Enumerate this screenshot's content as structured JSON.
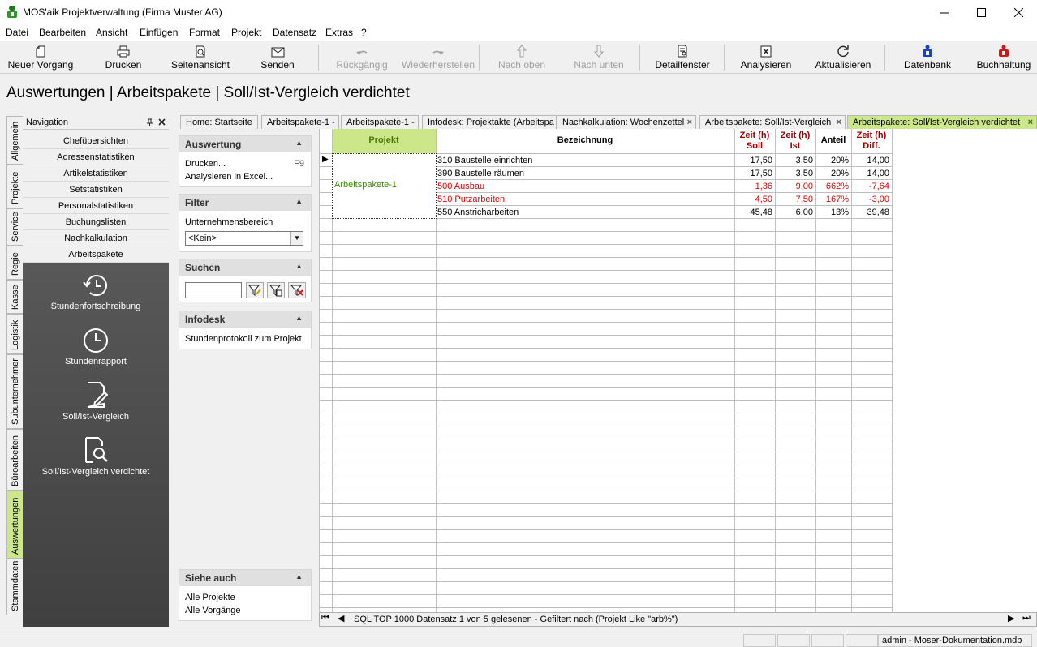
{
  "window": {
    "title": "MOS'aik Projektverwaltung (Firma Muster AG)"
  },
  "menu": [
    "Datei",
    "Bearbeiten",
    "Ansicht",
    "Einfügen",
    "Format",
    "Projekt",
    "Datensatz",
    "Extras",
    "?"
  ],
  "toolbar": [
    {
      "label": "Neuer Vorgang",
      "icon": "new-document-icon",
      "enabled": true
    },
    {
      "label": "Drucken",
      "icon": "printer-icon",
      "enabled": true
    },
    {
      "label": "Seitenansicht",
      "icon": "print-preview-icon",
      "enabled": true
    },
    {
      "label": "Senden",
      "icon": "envelope-icon",
      "enabled": true
    },
    {
      "label": "Rückgängig",
      "icon": "undo-icon",
      "enabled": false
    },
    {
      "label": "Wiederherstellen",
      "icon": "redo-icon",
      "enabled": false
    },
    {
      "label": "Nach oben",
      "icon": "arrow-up-icon",
      "enabled": false
    },
    {
      "label": "Nach unten",
      "icon": "arrow-down-icon",
      "enabled": false
    },
    {
      "label": "Detailfenster",
      "icon": "detail-window-icon",
      "enabled": true
    },
    {
      "label": "Analysieren",
      "icon": "excel-icon",
      "enabled": true
    },
    {
      "label": "Aktualisieren",
      "icon": "refresh-icon",
      "enabled": true
    },
    {
      "label": "Datenbank",
      "icon": "database-icon",
      "enabled": true
    },
    {
      "label": "Buchhaltung",
      "icon": "accounting-icon",
      "enabled": true
    }
  ],
  "page_title": "Auswertungen | Arbeitspakete | Soll/Ist-Vergleich verdichtet",
  "vertical_tabs": [
    "Allgemein",
    "Projekte",
    "Service",
    "Regie",
    "Kasse",
    "Logistik",
    "Subunternehmer",
    "Büroarbeiten",
    "Auswertungen",
    "Stammdaten"
  ],
  "vertical_tabs_active": "Auswertungen",
  "navigation": {
    "title": "Navigation",
    "items": [
      "Chefübersichten",
      "Adressenstatistiken",
      "Artikelstatistiken",
      "Setstatistiken",
      "Personalstatistiken",
      "Buchungslisten",
      "Nachkalkulation",
      "Arbeitspakete"
    ],
    "subitems": [
      {
        "label": "Stundenfortschreibung",
        "icon": "clock-back-icon"
      },
      {
        "label": "Stundenrapport",
        "icon": "clock-icon"
      },
      {
        "label": "Soll/Ist-Vergleich",
        "icon": "document-edit-icon"
      },
      {
        "label": "Soll/Ist-Vergleich verdichtet",
        "icon": "document-search-icon"
      }
    ]
  },
  "doc_tabs": [
    {
      "label": "Home: Startseite",
      "active": false
    },
    {
      "label": "Arbeitspakete-1 -",
      "active": false
    },
    {
      "label": "Arbeitspakete-1 -",
      "active": false
    },
    {
      "label": "Infodesk: Projektakte (Arbeitspa",
      "active": false
    },
    {
      "label": "Nachkalkulation: Wochenzettel",
      "active": false
    },
    {
      "label": "Arbeitspakete: Soll/Ist-Vergleich",
      "active": false
    },
    {
      "label": "Arbeitspakete: Soll/Ist-Vergleich verdichtet",
      "active": true
    }
  ],
  "task_panel": {
    "auswertung": {
      "title": "Auswertung",
      "items": [
        "Drucken...",
        "Analysieren in Excel..."
      ],
      "shortcut": "F9"
    },
    "filter": {
      "title": "Filter",
      "label": "Unternehmensbereich",
      "select_value": "<Kein>"
    },
    "suchen": {
      "title": "Suchen",
      "value": ""
    },
    "infodesk": {
      "title": "Infodesk",
      "items": [
        "Stundenprotokoll zum Projekt"
      ]
    },
    "siehe_auch": {
      "title": "Siehe auch",
      "items": [
        "Alle Projekte",
        "Alle Vorgänge"
      ]
    }
  },
  "grid": {
    "columns": [
      "Projekt",
      "Bezeichnung",
      "Zeit (h)\nSoll",
      "Zeit (h)\nIst",
      "Anteil",
      "Zeit (h)\nDiff."
    ],
    "project": "Arbeitspakete-1",
    "rows": [
      {
        "bez": "310 Baustelle einrichten",
        "soll": "17,50",
        "ist": "3,50",
        "anteil": "20%",
        "diff": "14,00",
        "red": false
      },
      {
        "bez": "390 Baustelle räumen",
        "soll": "17,50",
        "ist": "3,50",
        "anteil": "20%",
        "diff": "14,00",
        "red": false
      },
      {
        "bez": "500 Ausbau",
        "soll": "1,36",
        "ist": "9,00",
        "anteil": "662%",
        "diff": "-7,64",
        "red": true
      },
      {
        "bez": "510 Putzarbeiten",
        "soll": "4,50",
        "ist": "7,50",
        "anteil": "167%",
        "diff": "-3,00",
        "red": true
      },
      {
        "bez": "550 Anstricharbeiten",
        "soll": "45,48",
        "ist": "6,00",
        "anteil": "13%",
        "diff": "39,48",
        "red": false
      }
    ],
    "status": "SQL TOP 1000 Datensatz 1 von 5 gelesenen - Gefiltert nach (Projekt Like \"arb%\")"
  },
  "statusbar": {
    "text": "admin - Moser-Dokumentation.mdb"
  },
  "colors": {
    "accent_green": "#cce78a",
    "red": "#e00000",
    "header_red": "#a00000",
    "project_green": "#3a8a00"
  }
}
